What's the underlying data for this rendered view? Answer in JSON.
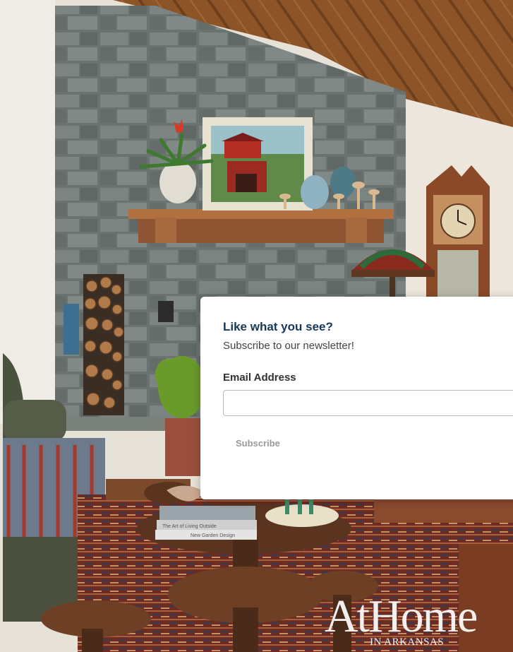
{
  "newsletter_popup": {
    "title": "Like what you see?",
    "subtitle": "Subscribe to our newsletter!",
    "email_label": "Email Address",
    "email_value": "",
    "email_placeholder": "",
    "subscribe_label": "Subscribe"
  },
  "logo": {
    "main": "AtHome",
    "sub": "IN ARKANSAS"
  },
  "photo": {
    "book_spine_1": "The Art of Living Outside",
    "book_spine_2": "New Garden Design"
  },
  "colors": {
    "title": "#14385a",
    "stone": "#6b7470",
    "wood_ceiling": "#8a5228",
    "mantel": "#9a5c35",
    "rug": "#6e2b22"
  },
  "icons": {
    "logo": "athome-wordmark"
  }
}
